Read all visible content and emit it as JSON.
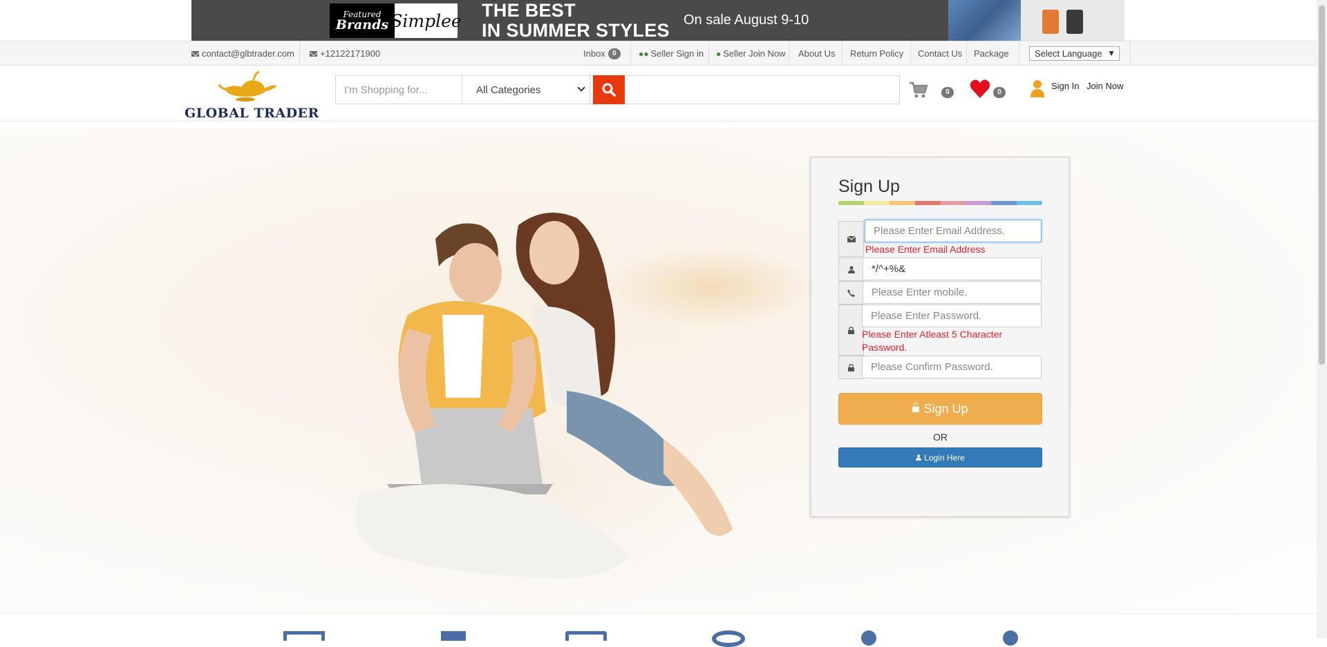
{
  "ad": {
    "featured_line1": "Featured",
    "featured_line2": "Brands",
    "brand": "Simplee",
    "headline_line1": "THE BEST",
    "headline_line2": "IN SUMMER STYLES",
    "sale_text": "On sale August 9-10"
  },
  "utility_bar": {
    "email": "contact@glbtrader.com",
    "phone": "+12122171900",
    "inbox_label": "Inbox",
    "inbox_count": "0",
    "seller_signin": "Seller Sign in",
    "seller_join": "Seller Join Now",
    "about": "About Us",
    "return_policy": "Return Policy",
    "contact": "Contact Us",
    "package": "Package",
    "language": "Select Language"
  },
  "header": {
    "logo_text": "GLOBAL TRADER",
    "search_placeholder": "I'm Shopping for...",
    "category_selected": "All Categories",
    "cart_count": "0",
    "wishlist_count": "0",
    "sign_in": "Sign In",
    "join_now": "Join Now"
  },
  "signup": {
    "title": "Sign Up",
    "email_placeholder": "Please Enter Email Address.",
    "email_error": "Please Enter Email Address",
    "username_value": "*/^+%&",
    "mobile_placeholder": "Please Enter mobile.",
    "password_placeholder": "Please Enter Password.",
    "password_error": "Please Enter Atleast 5 Character Password.",
    "confirm_placeholder": "Please Confirm Password.",
    "submit_label": "Sign Up",
    "or_label": "OR",
    "login_label": "Login Here"
  },
  "colors": {
    "search_button": "#e8380d",
    "signup_button": "#f0ad4e",
    "login_button": "#337ab7",
    "error_text": "#e3212b",
    "heart": "#e0101e",
    "user_icon": "#f0a020",
    "rainbow": [
      "#b7d36b",
      "#f4eba0",
      "#f8c471",
      "#e8746e",
      "#e79aa8",
      "#c99ad4",
      "#6f97d8",
      "#6cc0e3"
    ]
  }
}
